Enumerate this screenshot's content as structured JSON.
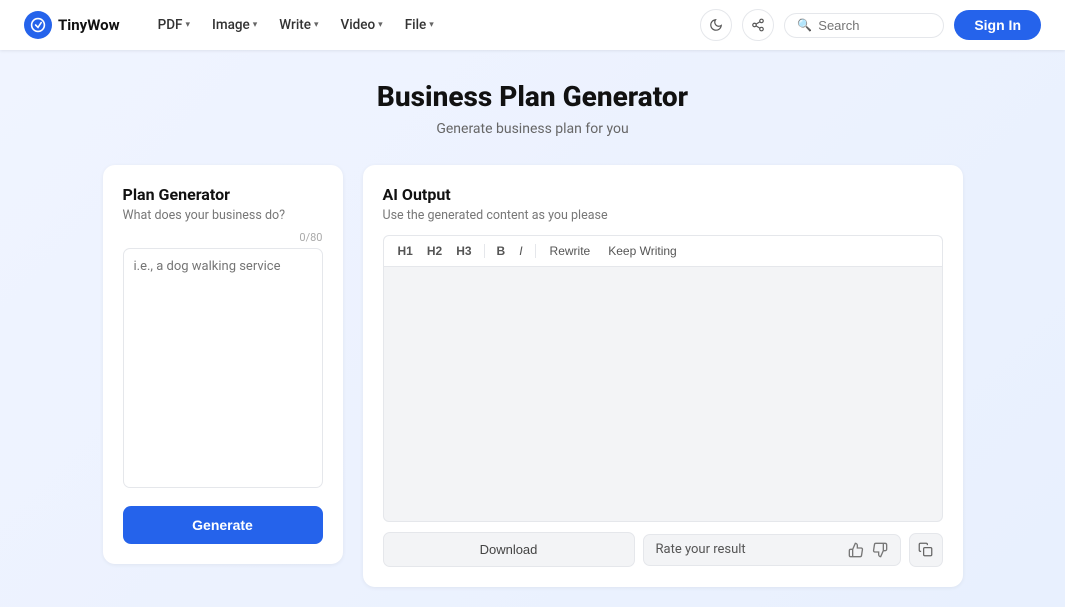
{
  "nav": {
    "logo_text": "TinyWow",
    "menu_items": [
      {
        "label": "PDF",
        "has_dropdown": true
      },
      {
        "label": "Image",
        "has_dropdown": true
      },
      {
        "label": "Write",
        "has_dropdown": true
      },
      {
        "label": "Video",
        "has_dropdown": true
      },
      {
        "label": "File",
        "has_dropdown": true
      }
    ],
    "search_placeholder": "Search",
    "sign_in_label": "Sign In"
  },
  "page": {
    "title": "Business Plan Generator",
    "subtitle": "Generate business plan for you"
  },
  "left_panel": {
    "title": "Plan Generator",
    "subtitle": "What does your business do?",
    "char_count": "0/80",
    "textarea_placeholder": "i.e., a dog walking service",
    "generate_label": "Generate"
  },
  "right_panel": {
    "title": "AI Output",
    "subtitle": "Use the generated content as you please",
    "toolbar": {
      "h1": "H1",
      "h2": "H2",
      "h3": "H3",
      "bold": "B",
      "italic": "I",
      "rewrite": "Rewrite",
      "keep_writing": "Keep Writing"
    },
    "download_label": "Download",
    "rate_label": "Rate your result"
  },
  "colors": {
    "primary": "#2563eb",
    "background": "#f3f4f6",
    "border": "#e5e7eb"
  }
}
